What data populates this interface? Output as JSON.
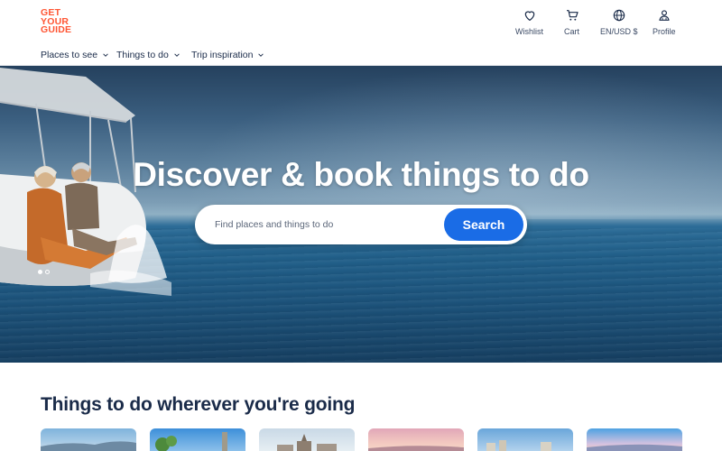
{
  "brand": {
    "logo_lines": [
      "GET",
      "YOUR",
      "GUIDE"
    ],
    "accent": "#ff5533",
    "primary_button": "#1a6ce6"
  },
  "header": {
    "utilities": [
      {
        "label": "Wishlist",
        "icon": "heart-icon"
      },
      {
        "label": "Cart",
        "icon": "cart-icon"
      },
      {
        "label": "EN/USD $",
        "icon": "globe-icon"
      },
      {
        "label": "Profile",
        "icon": "profile-icon"
      }
    ],
    "nav": [
      {
        "label": "Places to see"
      },
      {
        "label": "Things to do"
      },
      {
        "label": "Trip inspiration"
      }
    ]
  },
  "hero": {
    "title": "Discover & book things to do",
    "search": {
      "placeholder": "Find places and things to do",
      "value": "",
      "button_label": "Search"
    },
    "carousel": {
      "slides": 2,
      "active": 1
    }
  },
  "section": {
    "title": "Things to do wherever you're going",
    "cards": [
      {
        "icon": "destination-image-1"
      },
      {
        "icon": "destination-image-2"
      },
      {
        "icon": "destination-image-3"
      },
      {
        "icon": "destination-image-4"
      },
      {
        "icon": "destination-image-5"
      },
      {
        "icon": "destination-image-6"
      }
    ]
  }
}
